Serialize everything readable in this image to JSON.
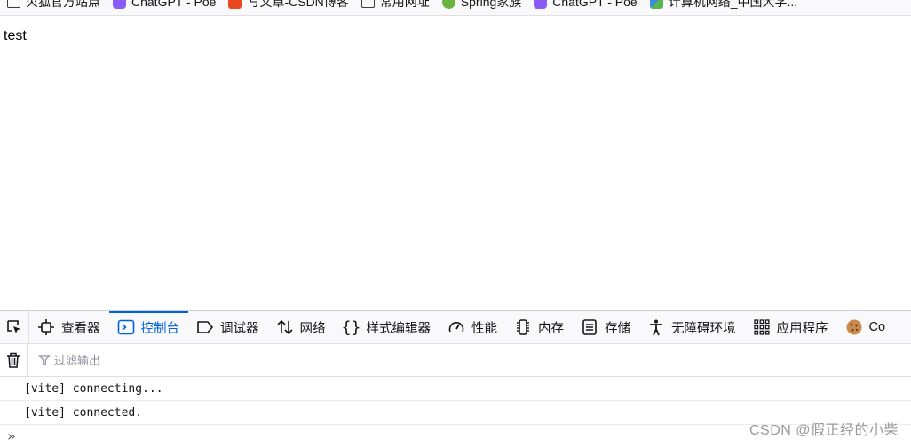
{
  "bookmarks": [
    {
      "label": "火狐官方站点",
      "icon": "folder-icon"
    },
    {
      "label": "ChatGPT - Poe",
      "icon": "poe-icon"
    },
    {
      "label": "写文章-CSDN博客",
      "icon": "csdn-icon"
    },
    {
      "label": "常用网址",
      "icon": "folder-icon"
    },
    {
      "label": "Spring家族",
      "icon": "spring-icon"
    },
    {
      "label": "ChatGPT - Poe",
      "icon": "poe-icon"
    },
    {
      "label": "计算机网络_中国大学...",
      "icon": "network-icon"
    }
  ],
  "page": {
    "text": "test"
  },
  "devtools": {
    "tabs": [
      {
        "label": "查看器",
        "icon": "inspector-icon"
      },
      {
        "label": "控制台",
        "icon": "console-icon",
        "selected": true
      },
      {
        "label": "调试器",
        "icon": "debugger-icon"
      },
      {
        "label": "网络",
        "icon": "network-arrows-icon"
      },
      {
        "label": "样式编辑器",
        "icon": "braces-icon"
      },
      {
        "label": "性能",
        "icon": "gauge-icon"
      },
      {
        "label": "内存",
        "icon": "memory-chip-icon"
      },
      {
        "label": "存储",
        "icon": "storage-icon"
      },
      {
        "label": "无障碍环境",
        "icon": "accessibility-icon"
      },
      {
        "label": "应用程序",
        "icon": "grid-icon"
      },
      {
        "label": "Co",
        "icon": "cookie-icon"
      }
    ],
    "filter_placeholder": "过滤输出",
    "messages": [
      "[vite] connecting...",
      "[vite] connected."
    ],
    "prompt_symbol": "»"
  },
  "watermark": "CSDN @假正经的小柴"
}
